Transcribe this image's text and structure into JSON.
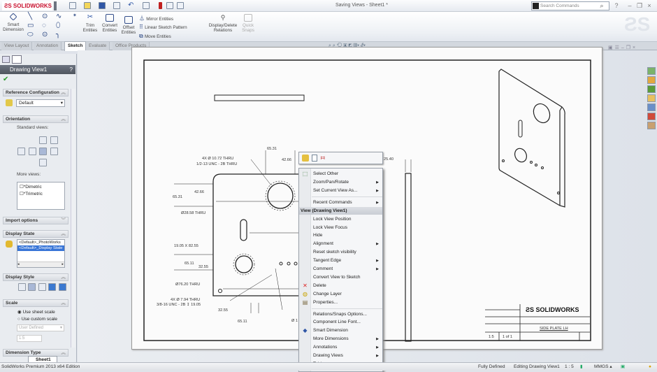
{
  "app": {
    "logo_text": "SOLIDWORKS",
    "window_title": "Saving Views - Sheet1 *",
    "search_placeholder": "Search Commands"
  },
  "ribbon": {
    "smart_dimension": "Smart Dimension",
    "trim": "Trim Entities",
    "convert": "Convert Entities",
    "offset": "Offset Entities",
    "mirror": "Mirror Entities",
    "linear_pattern": "Linear Sketch Pattern",
    "move": "Move Entities",
    "relations": "Display/Delete Relations",
    "quick_snaps": "Quick Snaps"
  },
  "tabs": [
    {
      "label": "View Layout"
    },
    {
      "label": "Annotation"
    },
    {
      "label": "Sketch",
      "active": true
    },
    {
      "label": "Evaluate"
    },
    {
      "label": "Office Products"
    }
  ],
  "panel": {
    "title": "Drawing View1",
    "reference_configuration": {
      "header": "Reference Configuration",
      "value": "Default"
    },
    "orientation": {
      "header": "Orientation",
      "standard_views": "Standard views:",
      "more_views": "More views:",
      "more_views_items": [
        "*Dimetric",
        "*Trimetric"
      ]
    },
    "import_options": {
      "header": "Import options"
    },
    "display_state": {
      "header": "Display State",
      "items": [
        "<Default>_PhotoWorks",
        "<Default>_Display State"
      ],
      "selected_index": 1
    },
    "display_style": {
      "header": "Display Style"
    },
    "scale": {
      "header": "Scale",
      "use_sheet_scale": "Use sheet scale",
      "use_custom_scale": "Use custom scale",
      "selected": "Use sheet scale",
      "custom_select": "User Defined",
      "custom_value": "1:5"
    },
    "dimension_type": {
      "header": "Dimension Type"
    }
  },
  "drawing": {
    "dims": {
      "d1": "65.31",
      "d2": "42.66",
      "d3": "4X Ø 10.72 THRU",
      "d4": "1/2-13 UNC - 2B THRU",
      "d5": "42.66",
      "d6": "65.31",
      "d7": "Ø28.58 THRU",
      "d8": "19.05 X 82.55",
      "d9": "65.11",
      "d10": "32.55",
      "d11": "Ø76.20 THRU",
      "d12": "4X Ø 7.94 THRU",
      "d13": "3/8-16 UNC - 2B ↧ 19.05",
      "d14": "32.55",
      "d15": "65.11",
      "d16": "Ø 1",
      "d17": "25.40"
    },
    "title_block": {
      "brand": "SOLIDWORKS",
      "part_name": "SIDE PLATE LH",
      "scale": "1:5",
      "sheet": "1 of 1"
    }
  },
  "context_menu": {
    "items": [
      {
        "label": "Select Other",
        "icon": "select-other-icon"
      },
      {
        "label": "Zoom/Pan/Rotate",
        "submenu": true
      },
      {
        "label": "Set Current View As...",
        "submenu": true
      },
      {
        "sep": true
      },
      {
        "label": "Recent Commands",
        "submenu": true
      },
      {
        "header": "View (Drawing View1)"
      },
      {
        "label": "Lock View Position"
      },
      {
        "label": "Lock View Focus"
      },
      {
        "label": "Hide"
      },
      {
        "label": "Alignment",
        "submenu": true
      },
      {
        "label": "Reset sketch visibility"
      },
      {
        "label": "Tangent Edge",
        "submenu": true
      },
      {
        "label": "Comment",
        "submenu": true
      },
      {
        "label": "Convert View to Sketch"
      },
      {
        "label": "Delete",
        "icon": "delete-icon"
      },
      {
        "label": "Change Layer",
        "icon": "layer-icon"
      },
      {
        "label": "Properties...",
        "icon": "properties-icon"
      },
      {
        "sep": true
      },
      {
        "label": "Relations/Snaps Options..."
      },
      {
        "label": "Component Line Font..."
      },
      {
        "label": "Smart Dimension",
        "icon": "smart-dimension-icon"
      },
      {
        "label": "More Dimensions",
        "submenu": true
      },
      {
        "label": "Annotations",
        "submenu": true
      },
      {
        "label": "Drawing Views",
        "submenu": true
      },
      {
        "label": "Tables",
        "submenu": true
      }
    ]
  },
  "sheet_tab": "Sheet1",
  "status": {
    "product": "SolidWorks Premium 2013 x64 Edition",
    "state": "Fully Defined",
    "editing": "Editing Drawing View1",
    "scale": "1 : 5",
    "units": "MMGS"
  },
  "task_pane_icons": [
    "resources-icon",
    "design-library-icon",
    "file-explorer-icon",
    "folder-icon",
    "view-palette-icon",
    "appearances-icon",
    "custom-properties-icon"
  ],
  "colors": {
    "accent": "#c8102e",
    "selection": "#3875d7"
  }
}
